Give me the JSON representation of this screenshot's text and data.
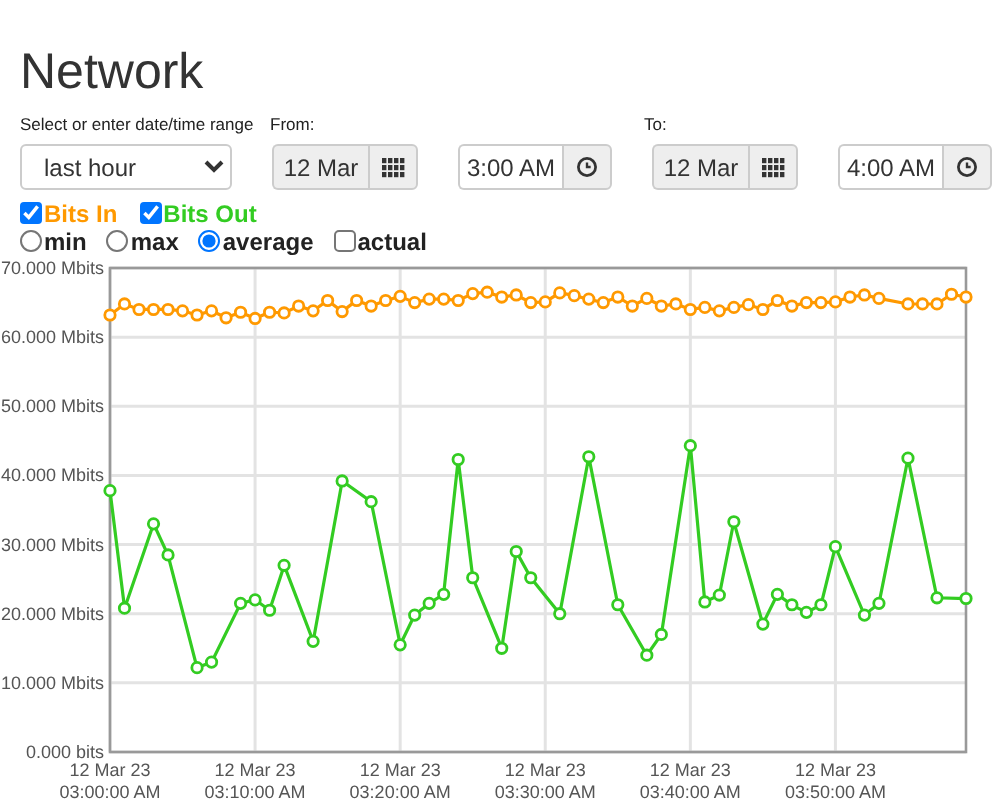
{
  "title": "Network",
  "range": {
    "label": "Select or enter date/time range",
    "value": "last hour"
  },
  "from": {
    "label": "From:",
    "date": "12 Mar",
    "time": "3:00 AM"
  },
  "to": {
    "label": "To:",
    "date": "12 Mar",
    "time": "4:00 AM"
  },
  "toggles": [
    {
      "checked": true
    },
    {
      "checked": true
    }
  ],
  "modes": [
    {
      "kind": "radio",
      "label": "min",
      "selected": false
    },
    {
      "kind": "radio",
      "label": "max",
      "selected": false
    },
    {
      "kind": "radio",
      "label": "average",
      "selected": true
    },
    {
      "kind": "checkbox",
      "label": "actual",
      "selected": false
    }
  ],
  "chart": {
    "chart_data": {
      "type": "line",
      "categories": [
        "12 Mar 23\n03:00:00 AM",
        null,
        null,
        null,
        null,
        null,
        null,
        null,
        null,
        null,
        "12 Mar 23\n03:10:00 AM",
        null,
        null,
        null,
        null,
        null,
        null,
        null,
        null,
        null,
        "12 Mar 23\n03:20:00 AM",
        null,
        null,
        null,
        null,
        null,
        null,
        null,
        null,
        null,
        "12 Mar 23\n03:30:00 AM",
        null,
        null,
        null,
        null,
        null,
        null,
        null,
        null,
        null,
        "12 Mar 23\n03:40:00 AM",
        null,
        null,
        null,
        null,
        null,
        null,
        null,
        null,
        null,
        "12 Mar 23\n03:50:00 AM",
        null,
        null,
        null,
        null,
        null,
        null,
        null,
        null,
        null
      ],
      "series": [
        {
          "name": "Bits In",
          "color": "#ff9900",
          "marker": "circle",
          "values": [
            63.2,
            64.8,
            64,
            64,
            64,
            63.8,
            63.2,
            63.8,
            62.8,
            63.6,
            62.7,
            63.6,
            63.5,
            64.5,
            63.8,
            65.3,
            63.7,
            65.3,
            64.5,
            65.3,
            65.9,
            65,
            65.5,
            65.5,
            65.3,
            66.3,
            66.5,
            65.8,
            66.1,
            65,
            65.1,
            66.4,
            66,
            65.5,
            65,
            65.8,
            64.5,
            65.6,
            64.5,
            64.8,
            64,
            64.3,
            63.8,
            64.3,
            64.7,
            64,
            65.3,
            64.5,
            65,
            65,
            65.1,
            65.8,
            66.1,
            65.6,
            null,
            64.8,
            64.8,
            64.8,
            66.2,
            65.8
          ]
        },
        {
          "name": "Bits Out",
          "color": "#33cc22",
          "marker": "circle",
          "values": [
            37.8,
            20.8,
            null,
            33,
            28.5,
            null,
            12.2,
            13,
            null,
            21.5,
            22,
            20.5,
            27,
            null,
            16,
            null,
            39.2,
            null,
            36.2,
            null,
            15.5,
            19.8,
            21.5,
            22.8,
            42.3,
            25.2,
            null,
            15,
            29,
            25.2,
            null,
            20,
            null,
            42.7,
            null,
            21.3,
            null,
            14,
            17,
            null,
            44.3,
            21.7,
            22.7,
            33.3,
            null,
            18.5,
            22.8,
            21.3,
            20.2,
            21.3,
            29.7,
            null,
            19.8,
            21.5,
            null,
            42.5,
            null,
            22.3,
            null,
            22.2
          ]
        }
      ],
      "ylim": [
        0,
        70
      ],
      "grid": true,
      "yticks": [
        {
          "value": 0,
          "label": "0.000 bits"
        },
        {
          "value": 10,
          "label": "10.000 Mbits"
        },
        {
          "value": 20,
          "label": "20.000 Mbits"
        },
        {
          "value": 30,
          "label": "30.000 Mbits"
        },
        {
          "value": 40,
          "label": "40.000 Mbits"
        },
        {
          "value": 50,
          "label": "50.000 Mbits"
        },
        {
          "value": 60,
          "label": "60.000 Mbits"
        },
        {
          "value": 70,
          "label": "70.000 Mbits"
        }
      ]
    }
  }
}
